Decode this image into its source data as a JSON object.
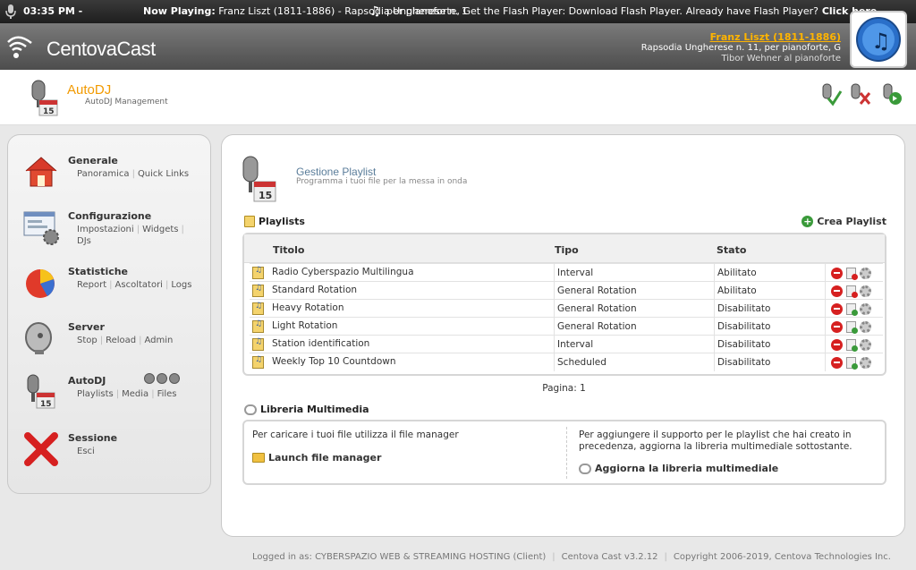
{
  "topbar": {
    "time": "03:35 PM - ",
    "now_playing_label": "Now Playing:",
    "now_playing_track": "Franz Liszt (1811-1886) - Rapsodia Ungherese n. 1",
    "flash_notice": "per pianoforte, Get the Flash Player: Download Flash Player.",
    "flash_already": "Already have Flash Player?",
    "flash_click": "Click here."
  },
  "brand": {
    "logo_text": "CentovaCast"
  },
  "track": {
    "artist": "Franz Liszt (1811-1886)",
    "title": "Rapsodia Ungherese n. 11, per pianoforte, G",
    "performer": "Tibor Wehner al pianoforte"
  },
  "subheader": {
    "title": "AutoDJ",
    "subtitle": "AutoDJ Management"
  },
  "sidebar": {
    "sections": [
      {
        "name": "Generale",
        "links": [
          "Panoramica",
          "Quick Links"
        ],
        "icon": "home-icon"
      },
      {
        "name": "Configurazione",
        "links": [
          "Impostazioni",
          "Widgets",
          "DJs"
        ],
        "icon": "config-icon"
      },
      {
        "name": "Statistiche",
        "links": [
          "Report",
          "Ascoltatori",
          "Logs"
        ],
        "icon": "pie-chart-icon"
      },
      {
        "name": "Server",
        "links": [
          "Stop",
          "Reload",
          "Admin"
        ],
        "icon": "satellite-dish-icon"
      },
      {
        "name": "AutoDJ",
        "links": [
          "Playlists",
          "Media",
          "Files"
        ],
        "icon": "microphone-icon"
      },
      {
        "name": "Sessione",
        "links": [
          "Esci"
        ],
        "icon": "red-x-icon"
      }
    ]
  },
  "main": {
    "title": "Gestione Playlist",
    "subtitle": "Programma i tuoi file per la messa in onda",
    "playlists_header": "Playlists",
    "create_label": "Crea Playlist",
    "columns": {
      "title": "Titolo",
      "type": "Tipo",
      "status": "Stato"
    },
    "rows": [
      {
        "title": "Radio Cyberspazio Multilingua",
        "type": "Interval",
        "status": "Abilitato"
      },
      {
        "title": "Standard Rotation",
        "type": "General Rotation",
        "status": "Abilitato"
      },
      {
        "title": "Heavy Rotation",
        "type": "General Rotation",
        "status": "Disabilitato"
      },
      {
        "title": "Light Rotation",
        "type": "General Rotation",
        "status": "Disabilitato"
      },
      {
        "title": "Station identification",
        "type": "Interval",
        "status": "Disabilitato"
      },
      {
        "title": "Weekly Top 10 Countdown",
        "type": "Scheduled",
        "status": "Disabilitato"
      }
    ],
    "pagination": "Pagina: 1",
    "library_header": "Libreria Multimedia",
    "library_left_text": "Per caricare i tuoi file utilizza il file manager",
    "launch_label": "Launch file manager",
    "library_right_text": "Per aggiungere il supporto per le playlist che hai creato in precedenza, aggiorna la libreria multimediale sottostante.",
    "update_label": "Aggiorna la libreria multimediale"
  },
  "footer": {
    "logged": "Logged in as: CYBERSPAZIO WEB & STREAMING HOSTING (Client)",
    "version": "Centova Cast v3.2.12",
    "copyright": "Copyright 2006-2019, Centova Technologies Inc."
  }
}
